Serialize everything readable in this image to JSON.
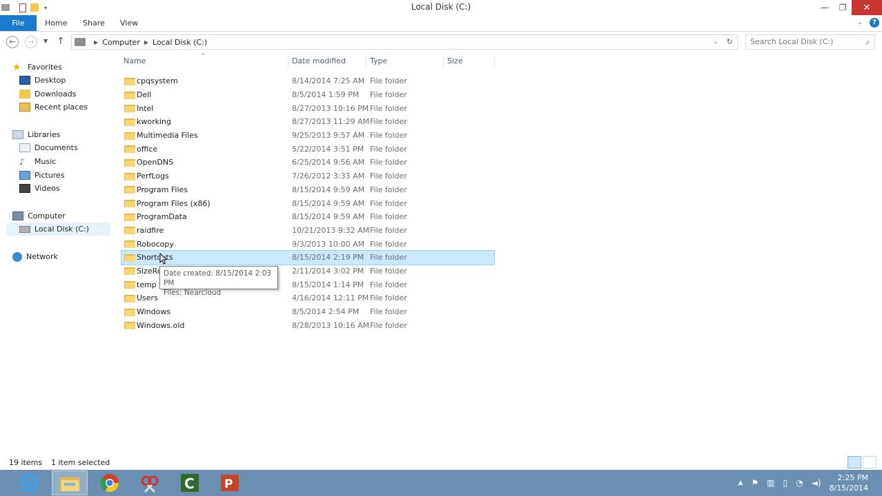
{
  "window": {
    "title": "Local Disk (C:)",
    "controls": {
      "minimize": "—",
      "maximize": "❐",
      "close": "✕"
    }
  },
  "ribbon": {
    "tabs": [
      "File",
      "Home",
      "Share",
      "View"
    ],
    "help": "?"
  },
  "address": {
    "crumbs": [
      "Computer",
      "Local Disk (C:)"
    ],
    "search_placeholder": "Search Local Disk (C:)"
  },
  "nav": {
    "favorites": {
      "label": "Favorites",
      "items": [
        "Desktop",
        "Downloads",
        "Recent places"
      ]
    },
    "libraries": {
      "label": "Libraries",
      "items": [
        "Documents",
        "Music",
        "Pictures",
        "Videos"
      ]
    },
    "computer": {
      "label": "Computer",
      "items": [
        "Local Disk (C:)"
      ]
    },
    "network": {
      "label": "Network"
    }
  },
  "columns": {
    "name": "Name",
    "date": "Date modified",
    "type": "Type",
    "size": "Size"
  },
  "files": [
    {
      "name": "cpqsystem",
      "date": "8/14/2014 7:25 AM",
      "type": "File folder"
    },
    {
      "name": "Dell",
      "date": "8/5/2014 1:59 PM",
      "type": "File folder"
    },
    {
      "name": "Intel",
      "date": "8/27/2013 10:16 PM",
      "type": "File folder"
    },
    {
      "name": "kworking",
      "date": "8/27/2013 11:29 AM",
      "type": "File folder"
    },
    {
      "name": "Multimedia Files",
      "date": "9/25/2013 9:57 AM",
      "type": "File folder"
    },
    {
      "name": "office",
      "date": "5/22/2014 3:51 PM",
      "type": "File folder"
    },
    {
      "name": "OpenDNS",
      "date": "6/25/2014 9:56 AM",
      "type": "File folder"
    },
    {
      "name": "PerfLogs",
      "date": "7/26/2012 3:33 AM",
      "type": "File folder"
    },
    {
      "name": "Program Files",
      "date": "8/15/2014 9:59 AM",
      "type": "File folder"
    },
    {
      "name": "Program Files (x86)",
      "date": "8/15/2014 9:59 AM",
      "type": "File folder"
    },
    {
      "name": "ProgramData",
      "date": "8/15/2014 9:59 AM",
      "type": "File folder"
    },
    {
      "name": "raidfire",
      "date": "10/21/2013 9:32 AM",
      "type": "File folder"
    },
    {
      "name": "Robocopy",
      "date": "9/3/2013 10:00 AM",
      "type": "File folder"
    },
    {
      "name": "Shortcuts",
      "date": "8/15/2014 2:19 PM",
      "type": "File folder",
      "selected": true
    },
    {
      "name": "SizeRep",
      "date": "2/11/2014 3:02 PM",
      "type": "File folder"
    },
    {
      "name": "temp",
      "date": "8/15/2014 1:14 PM",
      "type": "File folder"
    },
    {
      "name": "Users",
      "date": "4/16/2014 12:11 PM",
      "type": "File folder"
    },
    {
      "name": "Windows",
      "date": "8/5/2014 2:54 PM",
      "type": "File folder"
    },
    {
      "name": "Windows.old",
      "date": "8/28/2013 10:16 AM",
      "type": "File folder"
    }
  ],
  "tooltip": {
    "line1": "Date created: 8/15/2014 2:03 PM",
    "line2": "Files: Nearcloud"
  },
  "status": {
    "count": "19 items",
    "selected": "1 item selected"
  },
  "taskbar": {
    "apps": [
      "ie-icon",
      "file-explorer-icon",
      "chrome-icon",
      "snipping-tool-icon",
      "camtasia-icon",
      "powerpoint-icon"
    ],
    "clock_time": "2:25 PM",
    "clock_date": "8/15/2014"
  },
  "colors": {
    "accent": "#1979ca",
    "selection": "#cce8ff",
    "taskbar": "#6a8fb0",
    "folder": "#f6d675"
  }
}
